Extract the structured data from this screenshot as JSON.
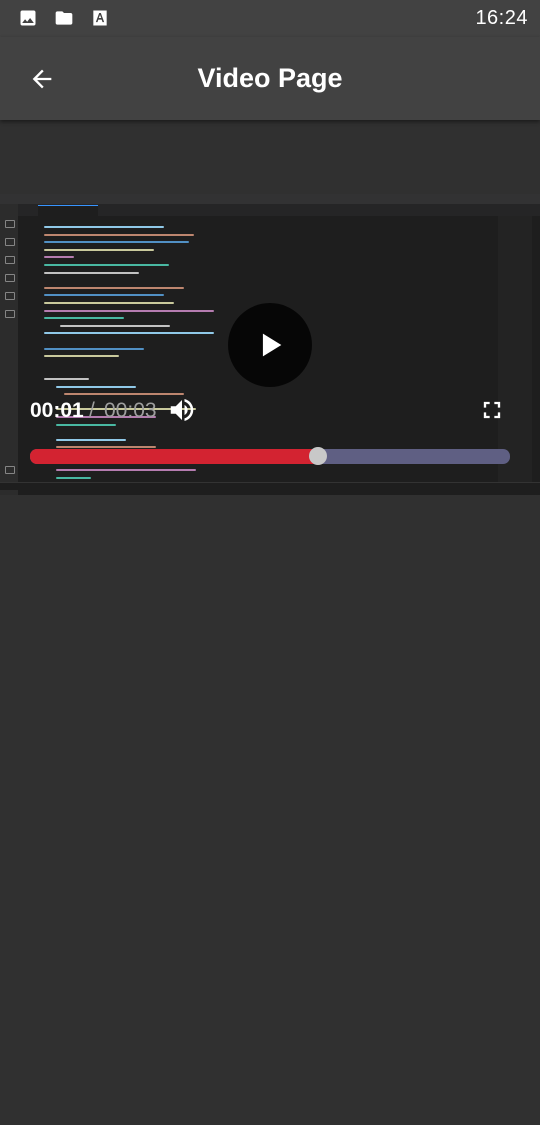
{
  "status_bar": {
    "time": "16:24",
    "icons": [
      "image-icon",
      "folder-icon",
      "text-document-icon"
    ]
  },
  "app_bar": {
    "title": "Video Page",
    "back_icon": "arrow-back-icon"
  },
  "player": {
    "current_time": "00:01",
    "separator": "/",
    "total_time": "00:03",
    "progress": 0.6,
    "play_icon": "play-icon",
    "volume_icon": "volume-up-icon",
    "fullscreen_icon": "fullscreen-icon",
    "colors": {
      "progress_played": "#d32331",
      "progress_remaining": "#5f5f83",
      "thumb": "#c8c8c8"
    }
  },
  "colors": {
    "background": "#303030",
    "app_bar": "#424242"
  }
}
